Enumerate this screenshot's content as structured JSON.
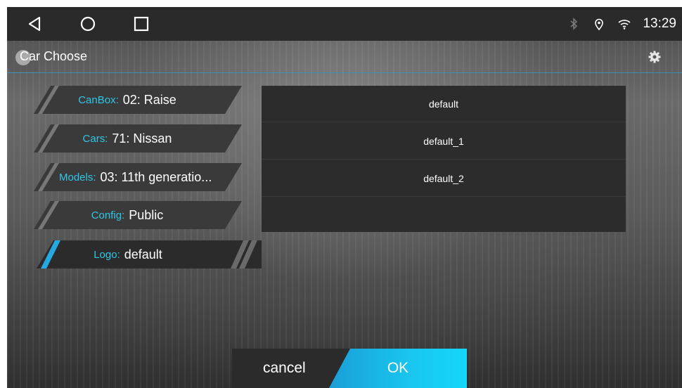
{
  "status_bar": {
    "nav": {
      "back_icon": "back-triangle-icon",
      "home_icon": "home-circle-icon",
      "recents_icon": "recents-square-icon"
    },
    "icons": [
      "bluetooth-icon",
      "location-icon",
      "wifi-icon"
    ],
    "time": "13:29"
  },
  "title_bar": {
    "title": "Car Choose",
    "settings_icon": "gear-icon"
  },
  "options": [
    {
      "key": "CanBox:",
      "value": "02: Raise"
    },
    {
      "key": "Cars:",
      "value": "71: Nissan"
    },
    {
      "key": "Models:",
      "value": "03: 11th generatio..."
    },
    {
      "key": "Config:",
      "value": "Public"
    },
    {
      "key": "Logo:",
      "value": "default",
      "selected": true
    }
  ],
  "logo_list": [
    "default",
    "default_1",
    "default_2"
  ],
  "buttons": {
    "cancel": "cancel",
    "ok": "OK"
  },
  "colors": {
    "accent": "#2ec7e8",
    "ok_button": "#19c6ef",
    "selected_stripe": "#26a9e0"
  }
}
